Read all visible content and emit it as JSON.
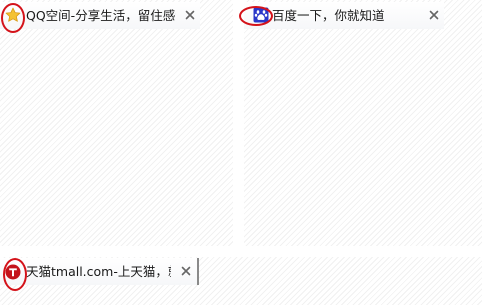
{
  "tabs": [
    {
      "title": "QQ空间-分享生活，留住感动",
      "icon": "star-icon",
      "close_icon": "close-icon"
    },
    {
      "title": "百度一下，你就知道",
      "icon": "baidu-paw-icon",
      "close_icon": "close-icon"
    },
    {
      "title": "天猫tmall.com-上天猫，就够了",
      "icon": "tmall-t-icon",
      "close_icon": "close-icon"
    }
  ],
  "colors": {
    "highlight_ring": "#d4131a",
    "baidu_blue": "#2a37c9",
    "tmall_red": "#c4141b",
    "star_yellow": "#f4c233"
  }
}
